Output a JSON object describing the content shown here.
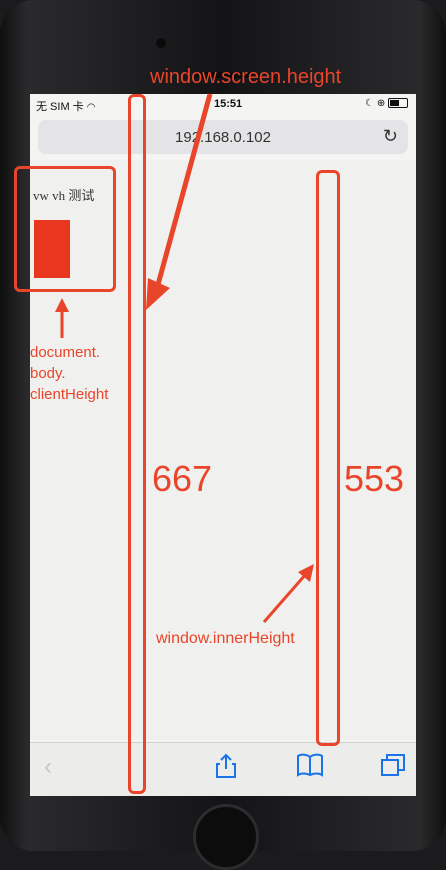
{
  "statusbar": {
    "carrier": "无 SIM 卡",
    "wifi_icon": "wifi-icon",
    "time": "15:51",
    "right_icons": "☾ ⊕"
  },
  "browser": {
    "url": "192.168.0.102",
    "reload_icon": "reload-icon"
  },
  "page": {
    "vw_text": "vw vh 测试"
  },
  "toolbar": {
    "back_icon": "back-icon",
    "share_icon": "share-icon",
    "bookmarks_icon": "bookmarks-icon",
    "tabs_icon": "tabs-icon"
  },
  "annotations": {
    "screen_height_label": "window.screen.height",
    "screen_height_value": "667",
    "body_label_1": "document.",
    "body_label_2": "body.",
    "body_label_3": "clientHeight",
    "inner_height_label": "window.innerHeight",
    "inner_height_value": "553",
    "color": "#e8452b"
  },
  "colors": {
    "accent": "#1a73e8",
    "red_block": "#e8361f"
  }
}
